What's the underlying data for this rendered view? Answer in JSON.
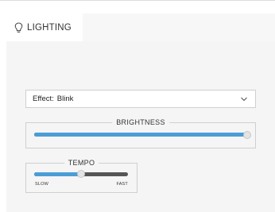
{
  "header": {
    "icon": "lightbulb-icon",
    "title": "LIGHTING"
  },
  "effect_select": {
    "label": "Effect:",
    "value": "Blink",
    "icon": "chevron-down-icon"
  },
  "brightness": {
    "label": "BRIGHTNESS",
    "level_percent": 100
  },
  "tempo": {
    "label": "TEMPO",
    "min_label": "SLOW",
    "max_label": "FAST",
    "level_percent": 50
  },
  "colors": {
    "accent": "#4a9dd6",
    "track": "#555555",
    "panel_bg": "#f5f5f5"
  }
}
